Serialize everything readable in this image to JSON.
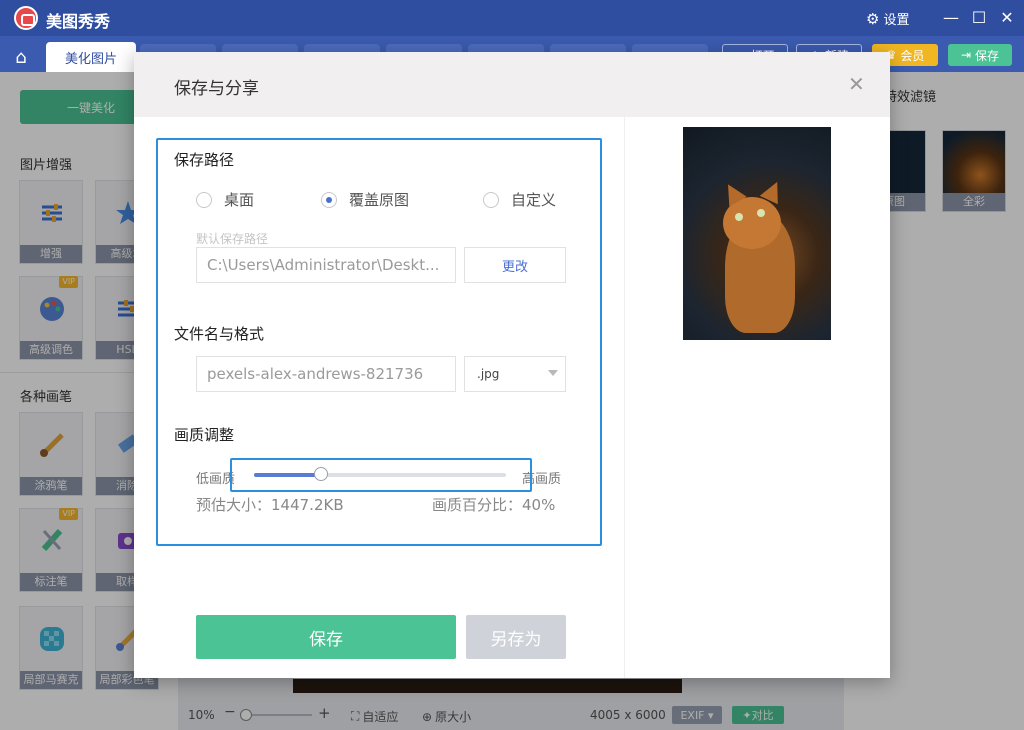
{
  "app": {
    "title": "美图秀秀",
    "settings_label": "设置"
  },
  "tabs": {
    "active": "美化图片"
  },
  "top_buttons": {
    "open": "打开",
    "new": "新建",
    "vip": "会员",
    "save": "保存"
  },
  "left_panel": {
    "one_click": "一键美化",
    "sections": [
      {
        "title": "图片增强",
        "tools": [
          {
            "label": "增强",
            "vip": false
          },
          {
            "label": "高级增",
            "vip": false
          },
          {
            "label": "高级调色",
            "vip": true
          },
          {
            "label": "HSL",
            "vip": false
          }
        ]
      },
      {
        "title": "各种画笔",
        "tools": [
          {
            "label": "涂鸦笔",
            "vip": false
          },
          {
            "label": "消除",
            "vip": false
          },
          {
            "label": "标注笔",
            "vip": true
          },
          {
            "label": "取样",
            "vip": false
          },
          {
            "label": "局部马赛克",
            "vip": false
          },
          {
            "label": "局部彩色笔",
            "vip": false
          }
        ]
      }
    ],
    "vip_badge": "VIP"
  },
  "right_panel": {
    "title": "特效滤镜",
    "filters": [
      {
        "label": "原图"
      },
      {
        "label": "全彩"
      }
    ]
  },
  "status_bar": {
    "zoom": "10%",
    "fit": "自适应",
    "original_size": "原大小",
    "dimensions": "4005 x 6000",
    "exif": "EXIF",
    "compare": "对比"
  },
  "dialog": {
    "title": "保存与分享",
    "path_section": "保存路径",
    "radio_options": [
      {
        "label": "桌面",
        "checked": false
      },
      {
        "label": "覆盖原图",
        "checked": true
      },
      {
        "label": "自定义",
        "checked": false
      }
    ],
    "default_path_hint": "默认保存路径",
    "path_value": "C:\\Users\\Administrator\\Deskt...",
    "change_button": "更改",
    "filename_section": "文件名与格式",
    "filename_value": "pexels-alex-andrews-821736",
    "format_value": ".jpg",
    "quality_section": "画质调整",
    "quality_low": "低画质",
    "quality_high": "高画质",
    "quality_percent": 40,
    "estimated_size": "预估大小：1447.2KB",
    "quality_percent_label": "画质百分比：40%",
    "save_button": "保存",
    "save_as_button": "另存为"
  },
  "colors": {
    "titlebar": "#2f4ea0",
    "accent_green": "#4bc394",
    "highlight_blue": "#2b8fe0",
    "slider_fill": "#5b7ad8"
  }
}
